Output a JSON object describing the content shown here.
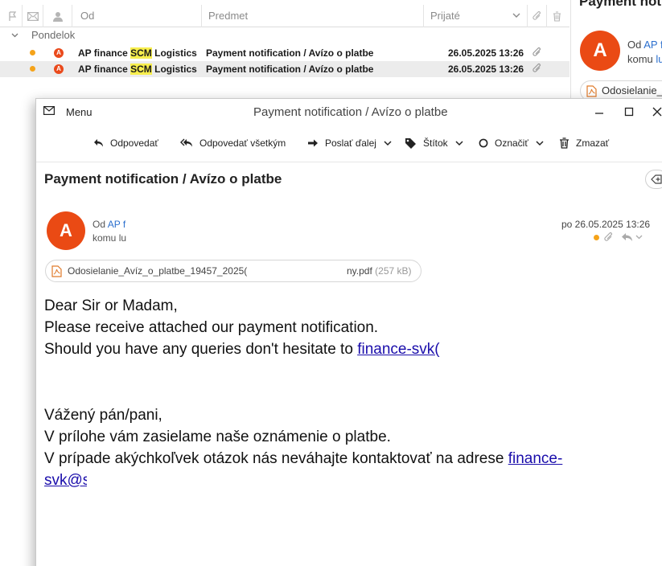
{
  "list": {
    "columns": {
      "from": "Od",
      "subject": "Predmet",
      "received": "Prijaté"
    },
    "group_label": "Pondelok",
    "rows": [
      {
        "sender_prefix": "AP finance ",
        "sender_highlight": "SCM",
        "sender_suffix": " Logistics ...",
        "subject": "Payment notification / Avízo o platbe",
        "date": "26.05.2025 13:26"
      },
      {
        "sender_prefix": "AP finance ",
        "sender_highlight": "SCM",
        "sender_suffix": " Logistics ...",
        "subject": "Payment notification / Avízo o platbe",
        "date": "26.05.2025 13:26"
      }
    ]
  },
  "preview": {
    "title": "Payment notification",
    "avatar_letter": "A",
    "from_label": "Od",
    "from_value": "AP f",
    "to_label": "komu",
    "to_value": "lu",
    "attachment": "Odosielanie_"
  },
  "window": {
    "menu_label": "Menu",
    "title": "Payment notification / Avízo o platbe",
    "toolbar": {
      "reply": "Odpovedať",
      "reply_all": "Odpovedať všetkým",
      "forward": "Poslať ďalej",
      "tag": "Štítok",
      "mark": "Označiť",
      "delete": "Zmazať"
    }
  },
  "message": {
    "subject": "Payment notification / Avízo o platbe",
    "avatar_letter": "A",
    "from_label": "Od",
    "from_value": "AP f",
    "to_label": "komu",
    "to_value": "lu",
    "date": "po 26.05.2025 13:26",
    "attachment": {
      "name": "Odosielanie_Avíz_o_platbe_19457_2025(",
      "ext": "ny.pdf",
      "size": "(257 kB)"
    },
    "body": {
      "greeting_en": "Dear Sir or Madam,",
      "line1_en": "Please receive attached our payment notification.",
      "line2_en_prefix": "Should you have any queries don't hesitate to ",
      "line2_en_link": "finance-svk(",
      "greeting_sk": "Vážený pán/pani,",
      "line1_sk": "V prílohe vám zasielame naše oznámenie o platbe.",
      "line2_sk_prefix": "V prípade akýchkoľvek otázok nás neváhajte kontaktovať na adrese ",
      "line2_sk_link": "finance-",
      "line3_sk_link": "svk@s"
    }
  },
  "colors": {
    "avatar": "#ea4a14",
    "unread_dot": "#f5a31a",
    "search_highlight": "#f7ee4d",
    "link": "#1a0dab",
    "sender_link": "#2b6fce"
  }
}
